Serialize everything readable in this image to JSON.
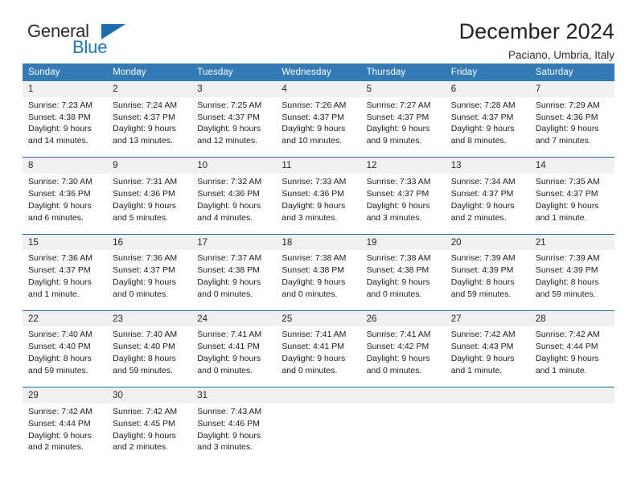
{
  "brand": {
    "name_top": "General",
    "name_bottom": "Blue",
    "triangle_color": "#1b6cb0",
    "text_color": "#2b2b2b",
    "accent_color": "#1b75bb"
  },
  "header": {
    "title": "December 2024",
    "subtitle": "Paciano, Umbria, Italy"
  },
  "theme": {
    "header_bg": "#337ab7",
    "daynum_bg": "#f0f0f0",
    "rule_color": "#2a6ca8"
  },
  "weekday_headers": [
    "Sunday",
    "Monday",
    "Tuesday",
    "Wednesday",
    "Thursday",
    "Friday",
    "Saturday"
  ],
  "weeks": [
    {
      "days": [
        {
          "num": "1",
          "sunrise": "Sunrise: 7:23 AM",
          "sunset": "Sunset: 4:38 PM",
          "daylight1": "Daylight: 9 hours",
          "daylight2": "and 14 minutes."
        },
        {
          "num": "2",
          "sunrise": "Sunrise: 7:24 AM",
          "sunset": "Sunset: 4:37 PM",
          "daylight1": "Daylight: 9 hours",
          "daylight2": "and 13 minutes."
        },
        {
          "num": "3",
          "sunrise": "Sunrise: 7:25 AM",
          "sunset": "Sunset: 4:37 PM",
          "daylight1": "Daylight: 9 hours",
          "daylight2": "and 12 minutes."
        },
        {
          "num": "4",
          "sunrise": "Sunrise: 7:26 AM",
          "sunset": "Sunset: 4:37 PM",
          "daylight1": "Daylight: 9 hours",
          "daylight2": "and 10 minutes."
        },
        {
          "num": "5",
          "sunrise": "Sunrise: 7:27 AM",
          "sunset": "Sunset: 4:37 PM",
          "daylight1": "Daylight: 9 hours",
          "daylight2": "and 9 minutes."
        },
        {
          "num": "6",
          "sunrise": "Sunrise: 7:28 AM",
          "sunset": "Sunset: 4:37 PM",
          "daylight1": "Daylight: 9 hours",
          "daylight2": "and 8 minutes."
        },
        {
          "num": "7",
          "sunrise": "Sunrise: 7:29 AM",
          "sunset": "Sunset: 4:36 PM",
          "daylight1": "Daylight: 9 hours",
          "daylight2": "and 7 minutes."
        }
      ]
    },
    {
      "days": [
        {
          "num": "8",
          "sunrise": "Sunrise: 7:30 AM",
          "sunset": "Sunset: 4:36 PM",
          "daylight1": "Daylight: 9 hours",
          "daylight2": "and 6 minutes."
        },
        {
          "num": "9",
          "sunrise": "Sunrise: 7:31 AM",
          "sunset": "Sunset: 4:36 PM",
          "daylight1": "Daylight: 9 hours",
          "daylight2": "and 5 minutes."
        },
        {
          "num": "10",
          "sunrise": "Sunrise: 7:32 AM",
          "sunset": "Sunset: 4:36 PM",
          "daylight1": "Daylight: 9 hours",
          "daylight2": "and 4 minutes."
        },
        {
          "num": "11",
          "sunrise": "Sunrise: 7:33 AM",
          "sunset": "Sunset: 4:36 PM",
          "daylight1": "Daylight: 9 hours",
          "daylight2": "and 3 minutes."
        },
        {
          "num": "12",
          "sunrise": "Sunrise: 7:33 AM",
          "sunset": "Sunset: 4:37 PM",
          "daylight1": "Daylight: 9 hours",
          "daylight2": "and 3 minutes."
        },
        {
          "num": "13",
          "sunrise": "Sunrise: 7:34 AM",
          "sunset": "Sunset: 4:37 PM",
          "daylight1": "Daylight: 9 hours",
          "daylight2": "and 2 minutes."
        },
        {
          "num": "14",
          "sunrise": "Sunrise: 7:35 AM",
          "sunset": "Sunset: 4:37 PM",
          "daylight1": "Daylight: 9 hours",
          "daylight2": "and 1 minute."
        }
      ]
    },
    {
      "days": [
        {
          "num": "15",
          "sunrise": "Sunrise: 7:36 AM",
          "sunset": "Sunset: 4:37 PM",
          "daylight1": "Daylight: 9 hours",
          "daylight2": "and 1 minute."
        },
        {
          "num": "16",
          "sunrise": "Sunrise: 7:36 AM",
          "sunset": "Sunset: 4:37 PM",
          "daylight1": "Daylight: 9 hours",
          "daylight2": "and 0 minutes."
        },
        {
          "num": "17",
          "sunrise": "Sunrise: 7:37 AM",
          "sunset": "Sunset: 4:38 PM",
          "daylight1": "Daylight: 9 hours",
          "daylight2": "and 0 minutes."
        },
        {
          "num": "18",
          "sunrise": "Sunrise: 7:38 AM",
          "sunset": "Sunset: 4:38 PM",
          "daylight1": "Daylight: 9 hours",
          "daylight2": "and 0 minutes."
        },
        {
          "num": "19",
          "sunrise": "Sunrise: 7:38 AM",
          "sunset": "Sunset: 4:38 PM",
          "daylight1": "Daylight: 9 hours",
          "daylight2": "and 0 minutes."
        },
        {
          "num": "20",
          "sunrise": "Sunrise: 7:39 AM",
          "sunset": "Sunset: 4:39 PM",
          "daylight1": "Daylight: 8 hours",
          "daylight2": "and 59 minutes."
        },
        {
          "num": "21",
          "sunrise": "Sunrise: 7:39 AM",
          "sunset": "Sunset: 4:39 PM",
          "daylight1": "Daylight: 8 hours",
          "daylight2": "and 59 minutes."
        }
      ]
    },
    {
      "days": [
        {
          "num": "22",
          "sunrise": "Sunrise: 7:40 AM",
          "sunset": "Sunset: 4:40 PM",
          "daylight1": "Daylight: 8 hours",
          "daylight2": "and 59 minutes."
        },
        {
          "num": "23",
          "sunrise": "Sunrise: 7:40 AM",
          "sunset": "Sunset: 4:40 PM",
          "daylight1": "Daylight: 8 hours",
          "daylight2": "and 59 minutes."
        },
        {
          "num": "24",
          "sunrise": "Sunrise: 7:41 AM",
          "sunset": "Sunset: 4:41 PM",
          "daylight1": "Daylight: 9 hours",
          "daylight2": "and 0 minutes."
        },
        {
          "num": "25",
          "sunrise": "Sunrise: 7:41 AM",
          "sunset": "Sunset: 4:41 PM",
          "daylight1": "Daylight: 9 hours",
          "daylight2": "and 0 minutes."
        },
        {
          "num": "26",
          "sunrise": "Sunrise: 7:41 AM",
          "sunset": "Sunset: 4:42 PM",
          "daylight1": "Daylight: 9 hours",
          "daylight2": "and 0 minutes."
        },
        {
          "num": "27",
          "sunrise": "Sunrise: 7:42 AM",
          "sunset": "Sunset: 4:43 PM",
          "daylight1": "Daylight: 9 hours",
          "daylight2": "and 1 minute."
        },
        {
          "num": "28",
          "sunrise": "Sunrise: 7:42 AM",
          "sunset": "Sunset: 4:44 PM",
          "daylight1": "Daylight: 9 hours",
          "daylight2": "and 1 minute."
        }
      ]
    },
    {
      "days": [
        {
          "num": "29",
          "sunrise": "Sunrise: 7:42 AM",
          "sunset": "Sunset: 4:44 PM",
          "daylight1": "Daylight: 9 hours",
          "daylight2": "and 2 minutes."
        },
        {
          "num": "30",
          "sunrise": "Sunrise: 7:42 AM",
          "sunset": "Sunset: 4:45 PM",
          "daylight1": "Daylight: 9 hours",
          "daylight2": "and 2 minutes."
        },
        {
          "num": "31",
          "sunrise": "Sunrise: 7:43 AM",
          "sunset": "Sunset: 4:46 PM",
          "daylight1": "Daylight: 9 hours",
          "daylight2": "and 3 minutes."
        },
        {
          "num": "",
          "sunrise": "",
          "sunset": "",
          "daylight1": "",
          "daylight2": "",
          "empty": true
        },
        {
          "num": "",
          "sunrise": "",
          "sunset": "",
          "daylight1": "",
          "daylight2": "",
          "empty": true
        },
        {
          "num": "",
          "sunrise": "",
          "sunset": "",
          "daylight1": "",
          "daylight2": "",
          "empty": true
        },
        {
          "num": "",
          "sunrise": "",
          "sunset": "",
          "daylight1": "",
          "daylight2": "",
          "empty": true
        }
      ]
    }
  ]
}
